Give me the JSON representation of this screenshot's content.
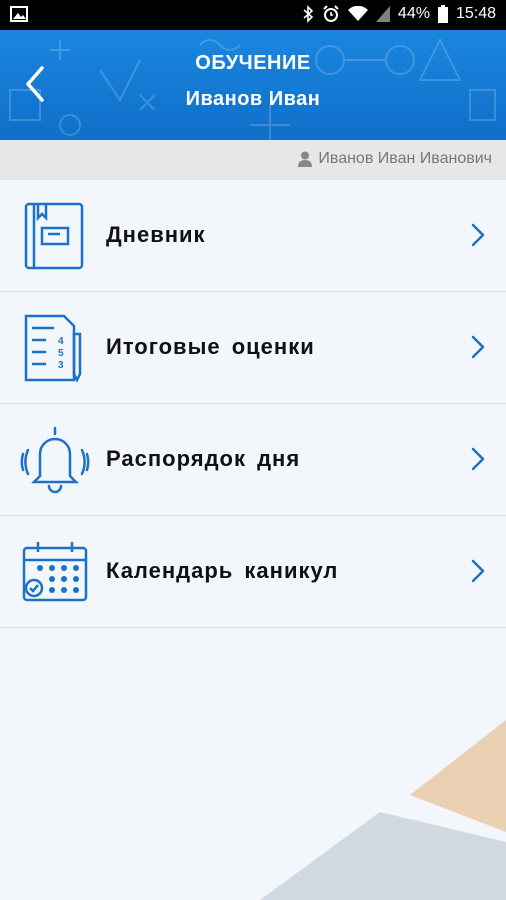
{
  "status_bar": {
    "battery": "44%",
    "time": "15:48",
    "icons": [
      "image-icon",
      "bluetooth-icon",
      "alarm-icon",
      "wifi-icon",
      "signal-icon",
      "battery-icon"
    ]
  },
  "header": {
    "title": "ОБУЧЕНИЕ",
    "subtitle": "Иванов Иван",
    "back_icon": "chevron-left-icon",
    "color": "#1a86e0"
  },
  "user_bar": {
    "user_name": "Иванов Иван Иванович",
    "icon": "user-icon"
  },
  "menu": {
    "items": [
      {
        "label": "Дневник",
        "icon": "diary-icon"
      },
      {
        "label": "Итоговые оценки",
        "icon": "grades-icon"
      },
      {
        "label": "Распорядок дня",
        "icon": "bell-icon"
      },
      {
        "label": "Календарь каникул",
        "icon": "calendar-icon"
      }
    ],
    "accent": "#1a73c8"
  }
}
